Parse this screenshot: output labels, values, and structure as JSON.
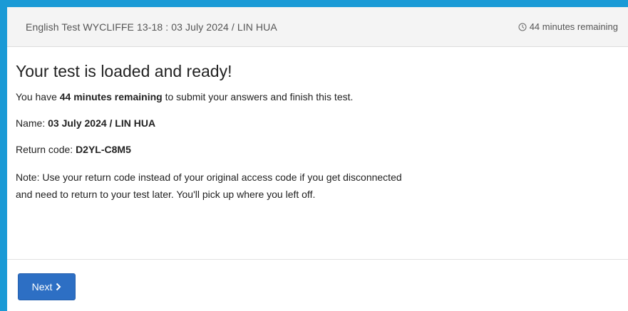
{
  "header": {
    "title": "English Test WYCLIFFE 13-18 : 03 July 2024 / LIN HUA",
    "timer_text": "44 minutes remaining",
    "timer_icon": "clock-icon"
  },
  "content": {
    "heading": "Your test is loaded and ready!",
    "remaining_prefix": "You have ",
    "remaining_bold": "44 minutes remaining",
    "remaining_suffix": " to submit your answers and finish this test.",
    "name_label": "Name: ",
    "name_value": "03 July 2024 / LIN HUA",
    "return_code_label": "Return code: ",
    "return_code_value": "D2YL-C8M5",
    "note_line1": "Note: Use your return code instead of your original access code if you get disconnected",
    "note_line2": "and need to return to your test later. You'll pick up where you left off."
  },
  "footer": {
    "next_label": "Next",
    "next_icon": "chevron-right-icon"
  },
  "colors": {
    "frame_accent": "#1a9ad6",
    "header_bg": "#f4f4f4",
    "button_bg": "#2d6fc4"
  }
}
